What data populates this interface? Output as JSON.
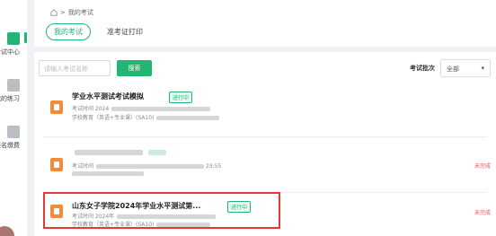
{
  "sidebar": {
    "items": [
      {
        "label": "考试中心",
        "icon": "edit-icon",
        "color": "#22b573"
      },
      {
        "label": "我的练习",
        "icon": "document-icon",
        "color": "#b9bdc4"
      },
      {
        "label": "报名缴费",
        "icon": "user-card-icon",
        "color": "#b9bdc4"
      }
    ]
  },
  "breadcrumb": {
    "home_icon": "home-icon",
    "separator": ">",
    "current": "我的考试"
  },
  "tabs": [
    {
      "label": "我的考试",
      "active": true
    },
    {
      "label": "准考证打印",
      "active": false
    }
  ],
  "filter": {
    "search_placeholder": "请输入考试名称",
    "search_button": "搜索",
    "batch_label": "考试批次",
    "batch_value": "全部"
  },
  "exams": [
    {
      "title": "学业水平测试考试模拟",
      "badge": "进行中",
      "time_label": "考试时间 2024",
      "time_tail": "",
      "info_label": "学校教育（英语+专业课）(SA10)",
      "status": ""
    },
    {
      "title": "",
      "badge": "",
      "time_label": "考试时间",
      "time_tail": "23:55",
      "info_label": "",
      "status": "未完成"
    },
    {
      "title": "山东女子学院2024年学业水平测试第...",
      "badge": "进行中",
      "time_label": "考试时间 2024年",
      "time_tail": "",
      "info_label": "学校教育（英语+专业课）(SA10)",
      "status": "未完成"
    }
  ],
  "colors": {
    "accent": "#22b573",
    "icon_orange": "#f28c3c",
    "status_red": "#e05555",
    "highlight": "#e53935"
  }
}
